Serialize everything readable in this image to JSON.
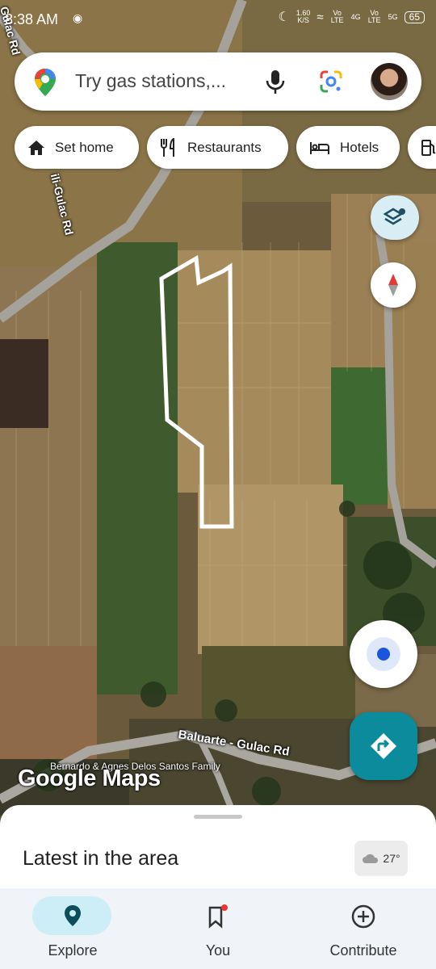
{
  "status_bar": {
    "time": "8:38 AM",
    "speed": "1.60",
    "speed_unit": "K/S",
    "volte1": "Vo LTE",
    "net_4g": "4G",
    "volte2": "Vo LTE",
    "net_5g": "5G",
    "battery": "65"
  },
  "search": {
    "placeholder": "Try gas stations,..."
  },
  "chips": [
    {
      "label": "Set home",
      "icon": "home-icon"
    },
    {
      "label": "Restaurants",
      "icon": "restaurant-icon"
    },
    {
      "label": "Hotels",
      "icon": "hotel-icon"
    }
  ],
  "map": {
    "road_labels": [
      "Gulac Rd",
      "ili-Gulac Rd",
      "Baluarte - Gulac Rd"
    ],
    "place_label": "Bernardo & Agnes Delos Santos Family",
    "logo": "Google Maps"
  },
  "sheet": {
    "title": "Latest in the area",
    "temperature": "27°"
  },
  "nav": [
    {
      "label": "Explore",
      "icon": "explore-pin-icon",
      "active": true
    },
    {
      "label": "You",
      "icon": "bookmark-icon",
      "active": false
    },
    {
      "label": "Contribute",
      "icon": "add-circle-icon",
      "active": false
    }
  ],
  "colors": {
    "accent": "#0b8b9b",
    "nav_active_bg": "#cdeef6",
    "location_blue": "#1a56db"
  }
}
